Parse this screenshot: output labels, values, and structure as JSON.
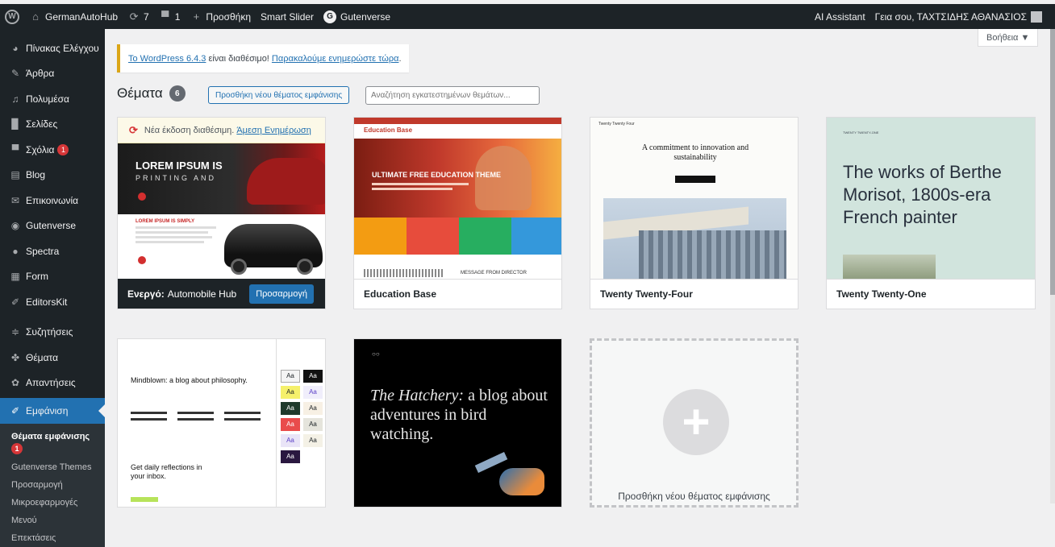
{
  "adminbar": {
    "site_name": "GermanAutoHub",
    "updates_count": "7",
    "comments_count": "1",
    "new_label": "Προσθήκη",
    "smart_slider": "Smart Slider",
    "gutenverse": "Gutenverse",
    "ai_assistant": "AI Assistant",
    "greeting": "Γεια σου, ΤΑΧΤΣΙΔΗΣ ΑΘΑΝΑΣΙΟΣ"
  },
  "sidebar": {
    "items": [
      {
        "label": "Πίνακας Ελέγχου",
        "icon": "dashboard-icon"
      },
      {
        "label": "Άρθρα",
        "icon": "pin-icon"
      },
      {
        "label": "Πολυμέσα",
        "icon": "media-icon"
      },
      {
        "label": "Σελίδες",
        "icon": "page-icon"
      },
      {
        "label": "Σχόλια",
        "icon": "comment-icon",
        "badge": "1"
      },
      {
        "label": "Blog",
        "icon": "blog-icon"
      },
      {
        "label": "Επικοινωνία",
        "icon": "mail-icon"
      },
      {
        "label": "Gutenverse",
        "icon": "gutenverse-icon"
      },
      {
        "label": "Spectra",
        "icon": "spectra-icon"
      },
      {
        "label": "Form",
        "icon": "form-icon"
      },
      {
        "label": "EditorsKit",
        "icon": "pen-icon"
      },
      {
        "label": "Συζητήσεις",
        "icon": "forum-icon"
      },
      {
        "label": "Θέματα",
        "icon": "topics-icon"
      },
      {
        "label": "Απαντήσεις",
        "icon": "replies-icon"
      },
      {
        "label": "Εμφάνιση",
        "icon": "brush-icon"
      }
    ],
    "submenu": {
      "current": "Θέματα εμφάνισης",
      "current_badge": "1",
      "items": [
        "Gutenverse Themes",
        "Προσαρμογή",
        "Μικροεφαρμογές",
        "Μενού",
        "Επεκτάσεις"
      ]
    }
  },
  "help": "Βοήθεια ▼",
  "notice": {
    "link1": "Το WordPress 6.4.3",
    "middle": " είναι διαθέσιμο! ",
    "link2": "Παρακαλούμε ενημερώστε τώρα",
    "end": "."
  },
  "page": {
    "title": "Θέματα",
    "count": "6",
    "add_new": "Προσθήκη νέου θέματος εμφάνισης",
    "search_placeholder": "Αναζήτηση εγκατεστημένων θεμάτων..."
  },
  "themes": {
    "active": {
      "update_text": "Νέα έκδοση διαθέσιμη.",
      "update_link": "Άμεση Ενημέρωση",
      "active_label": "Ενεργό:",
      "name": "Automobile Hub",
      "customize": "Προσαρμογή",
      "shot_headline1": "LOREM IPSUM IS",
      "shot_headline2": "PRINTING AND",
      "shot_headline3": "LOREM IPSUM IS SIMPLY"
    },
    "education": {
      "name": "Education Base",
      "shot_logo": "Education Base",
      "shot_title": "ULTIMATE FREE EDUCATION THEME",
      "shot_footer": "MESSAGE FROM DIRECTOR",
      "colors": [
        "#f39c12",
        "#e74c3c",
        "#27ae60",
        "#3498db"
      ]
    },
    "twentyfour": {
      "name": "Twenty Twenty-Four",
      "shot_brand": "Twenty Twenty Four",
      "shot_title": "A commitment to innovation and sustainability"
    },
    "twentyone": {
      "name": "Twenty Twenty-One",
      "shot_brand": "TWENTY TWENTY-ONE",
      "shot_title": "The works of Berthe Morisot, 1800s-era French painter"
    },
    "twentytwo_philo": {
      "shot_title": "Mindblown: a blog about philosophy.",
      "shot_cta": "Get daily reflections in your inbox.",
      "styles_label": "Aa"
    },
    "hatchery": {
      "shot_title_italic": "The Hatchery:",
      "shot_title_rest": " a blog about adventures in bird watching."
    },
    "add_new": "Προσθήκη νέου θέματος εμφάνισης"
  }
}
